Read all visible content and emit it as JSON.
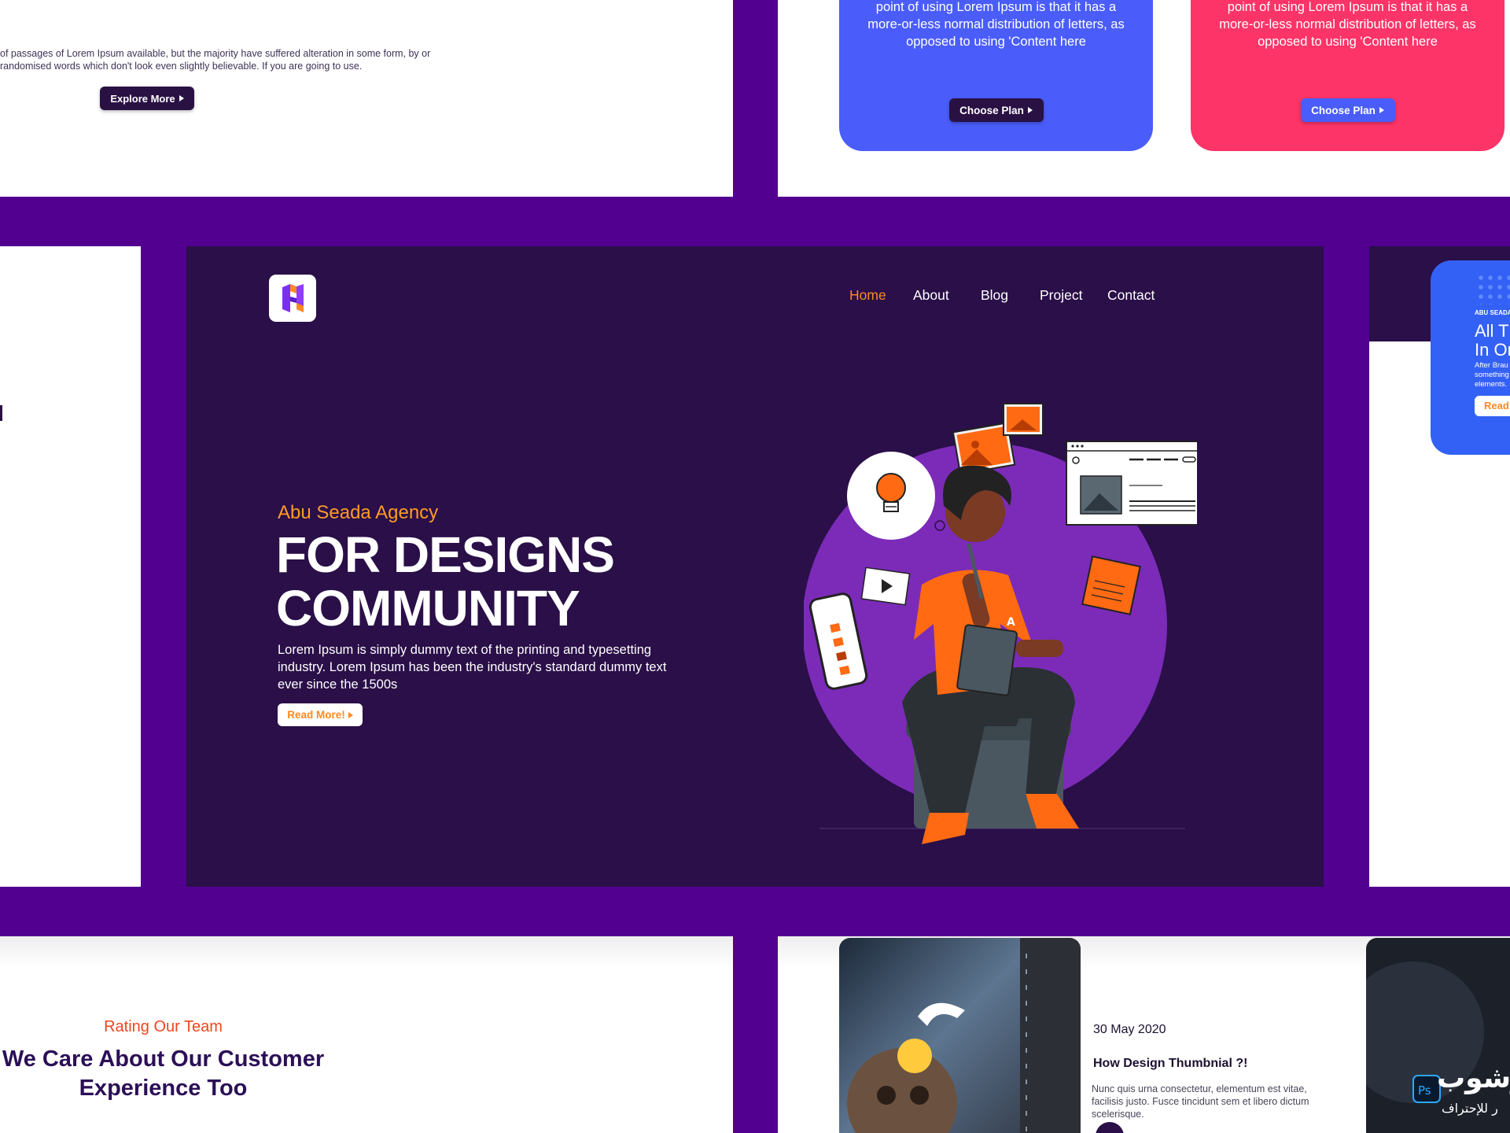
{
  "top_left": {
    "paragraph": "of passages of Lorem Ipsum available, but the majority have suffered alteration in some form, by or randomised words which don't look even slightly believable. If you are going to use.",
    "button": "Explore More"
  },
  "pricing": {
    "cards": [
      {
        "text": "point of using Lorem Ipsum is that it has a more-or-less normal distribution of letters, as opposed to using 'Content here",
        "button": "Choose Plan",
        "color": "#4a5dfa",
        "button_color": "#2a1144"
      },
      {
        "text": "point of using Lorem Ipsum is that it has a more-or-less normal distribution of letters, as opposed to using 'Content here",
        "button": "Choose Plan",
        "color": "#fd3468",
        "button_color": "#4a5dfa"
      }
    ]
  },
  "hero": {
    "nav": [
      "Home",
      "About",
      "Blog",
      "Project",
      "Contact"
    ],
    "active_nav": "Home",
    "subtitle": "Abu Seada Agency",
    "title_line1": "FOR DESIGNS",
    "title_line2": "COMMUNITY",
    "paragraph": "Lorem Ipsum is simply dummy text of the printing and typesetting industry. Lorem Ipsum has been the industry's standard dummy text ever since the 1500s",
    "button": "Read More!",
    "accent": "#ff8a1f",
    "background": "#2a0f48",
    "shirt_letter": "A"
  },
  "side_card": {
    "label": "ABU SEADA",
    "heading": "All T\nIn Or",
    "text": "After Brau\nsomething\nelements.",
    "button": "Read"
  },
  "team": {
    "label": "Rating Our Team",
    "heading": "We Care About Our Customer Experience Too"
  },
  "blog": {
    "date": "30 May 2020",
    "title": "How Design Thumbnial ?!",
    "description": "Nunc quis urna consectetur, elementum est vitae, facilisis justo. Fusce tincidunt sem et libero dictum scelerisque.",
    "thumb_badge": "Ps",
    "arabic_text": "فوتوشوب",
    "arabic_sub": "ر للإحتراف"
  },
  "colors": {
    "frame": "#52008f",
    "white": "#ffffff"
  }
}
